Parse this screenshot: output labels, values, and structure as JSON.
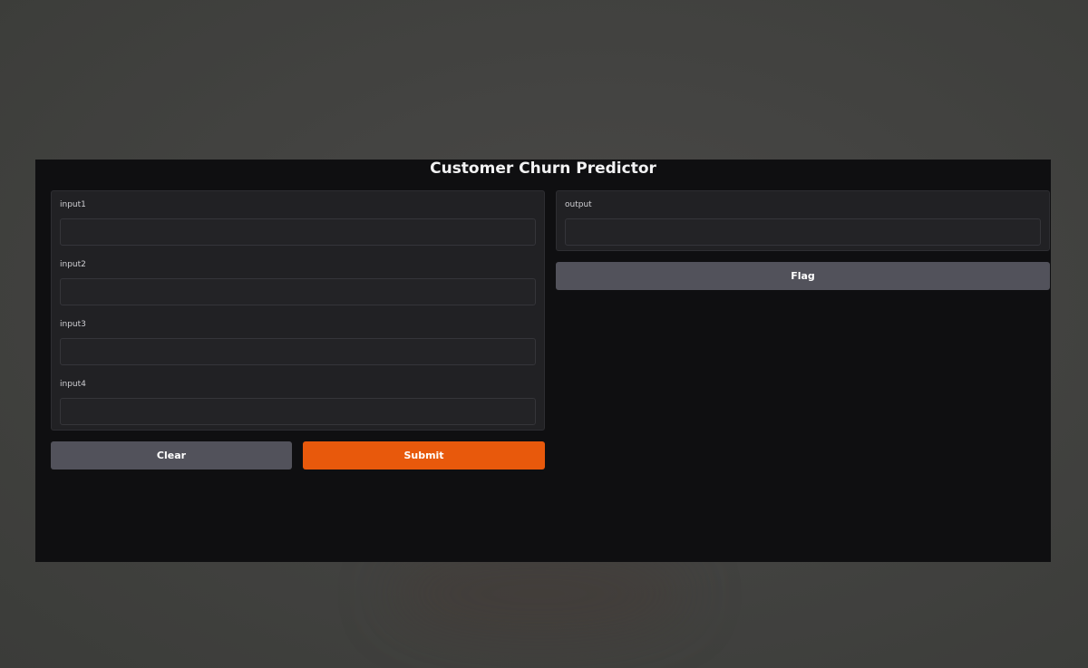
{
  "app": {
    "title": "Customer Churn Predictor"
  },
  "inputs": [
    {
      "label": "input1",
      "value": ""
    },
    {
      "label": "input2",
      "value": ""
    },
    {
      "label": "input3",
      "value": ""
    },
    {
      "label": "input4",
      "value": ""
    }
  ],
  "output": {
    "label": "output",
    "value": ""
  },
  "buttons": {
    "clear": "Clear",
    "submit": "Submit",
    "flag": "Flag"
  },
  "colors": {
    "accent": "#e8590c",
    "secondary_button": "#52525b",
    "app_background": "#0f0f11",
    "panel_background": "#212124"
  }
}
